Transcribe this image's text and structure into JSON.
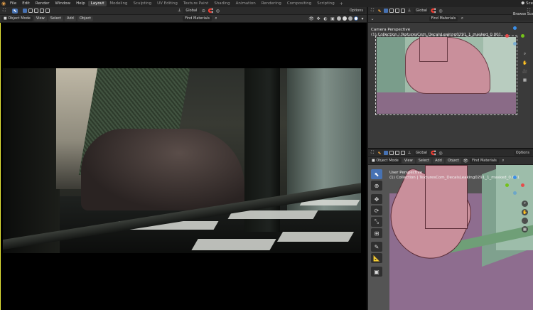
{
  "topbar": {
    "logo": "blender-logo",
    "menus": [
      "File",
      "Edit",
      "Render",
      "Window",
      "Help"
    ],
    "workspaces": [
      "Layout",
      "Modeling",
      "Sculpting",
      "UV Editing",
      "Texture Paint",
      "Shading",
      "Animation",
      "Rendering",
      "Compositing",
      "Scripting"
    ],
    "active_workspace": "Layout",
    "add_workspace": "+",
    "scene": "Sce"
  },
  "main_editor": {
    "header": {
      "transform": "Global",
      "options": "Options"
    },
    "header2": {
      "mode": "Object Mode",
      "menus": [
        "View",
        "Select",
        "Add",
        "Object"
      ],
      "find_materials": "Find Materials"
    }
  },
  "camera_editor": {
    "header": {
      "transform": "Global",
      "find_materials": "Find Materials"
    },
    "overlay_title": "Camera Perspective",
    "overlay_subtitle": "(1) Collection | TexturesCom_DecalsLeaking0291_1_masked_0.001",
    "right_tab": "Browse Scene"
  },
  "user_editor": {
    "header": {
      "transform": "Global",
      "options": "Options"
    },
    "header2": {
      "mode": "Object Mode",
      "menus": [
        "View",
        "Select",
        "Add",
        "Object"
      ],
      "find_materials": "Find Materials"
    },
    "overlay_title": "User Perspective",
    "overlay_subtitle": "(1) Collection | TexturesCom_DecalsLeaking0291_1_masked_0.001"
  },
  "tools": [
    "select-box-icon",
    "cursor-icon",
    "move-icon",
    "rotate-icon",
    "scale-icon",
    "transform-icon",
    "annotate-icon",
    "measure-icon",
    "add-cube-icon"
  ],
  "colors": {
    "accent": "#4772b3",
    "gizmo_x": "#e64b4b",
    "gizmo_y": "#74c21a",
    "gizmo_z": "#3b8fe8",
    "active_border": "#e8e838"
  }
}
